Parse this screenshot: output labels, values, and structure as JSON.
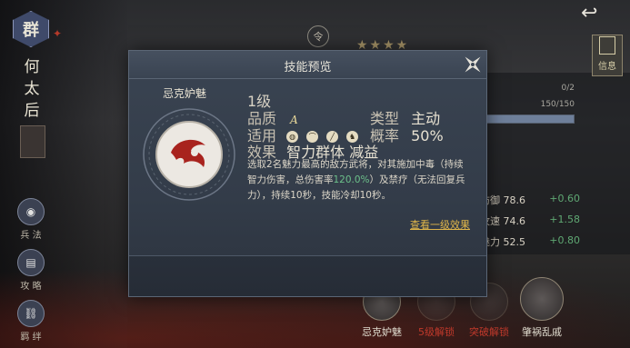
{
  "hero": {
    "faction": "群",
    "name": "何太后"
  },
  "sidebar": {
    "items": [
      {
        "label": "兵 法",
        "icon": "book-icon"
      },
      {
        "label": "攻 略",
        "icon": "scroll-icon"
      },
      {
        "label": "羁 绊",
        "icon": "link-icon"
      }
    ]
  },
  "topbar": {
    "info_label": "信息",
    "emblem": "令"
  },
  "progress": {
    "a_text": "0/2",
    "a_fraction": 0,
    "b_text": "150/150",
    "b_fraction": 1
  },
  "stats": [
    {
      "label": "防御",
      "value": "78.6",
      "increase": "+0.60"
    },
    {
      "label": "攻速",
      "value": "74.6",
      "increase": "+1.58"
    },
    {
      "label": "魅力",
      "value": "52.5",
      "increase": "+0.80"
    }
  ],
  "bottom_skills": [
    {
      "label": "忌克妒魅",
      "color": "#e0dccf"
    },
    {
      "label": "5级解锁",
      "color": "#c0392b"
    },
    {
      "label": "突破解锁",
      "color": "#c0392b"
    },
    {
      "label": "肇祸乱戚",
      "color": "#e0dccf"
    }
  ],
  "modal": {
    "title": "技能预览",
    "skill_name": "忌克妒魅",
    "level": "1级",
    "quality_label": "品质",
    "quality_value": "A",
    "type_label": "类型",
    "type_value": "主动",
    "apply_label": "适用",
    "apply_icons": [
      "shield-unit-icon",
      "bow-unit-icon",
      "spear-unit-icon",
      "cavalry-unit-icon"
    ],
    "prob_label": "概率",
    "prob_value": "50%",
    "effect_label": "效果",
    "effect_value": "智力群体 减益",
    "desc_part1": "选取2名魅力最高的敌方武将，对其施加中毒（持续智力伤害，总伤害率",
    "desc_highlight": "120.0%",
    "desc_part2": "）及禁疗（无法回复兵力），持续10秒，技能冷却10秒。",
    "link_text": "查看一级效果"
  }
}
